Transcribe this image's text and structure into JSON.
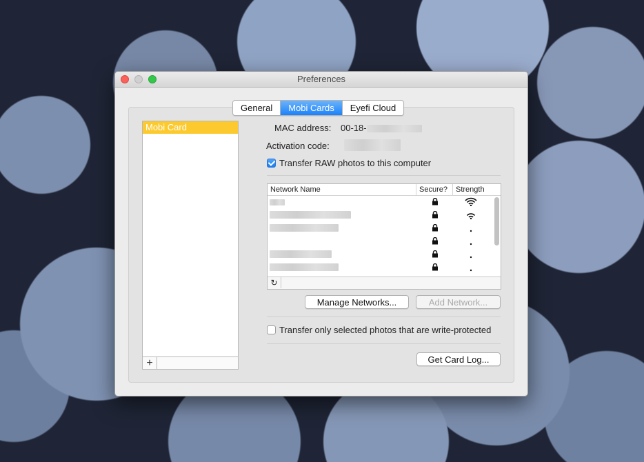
{
  "window": {
    "title": "Preferences"
  },
  "tabs": [
    {
      "label": "General",
      "active": false
    },
    {
      "label": "Mobi Cards",
      "active": true
    },
    {
      "label": "Eyefi Cloud",
      "active": false
    }
  ],
  "card_list": {
    "items": [
      "Mobi Card"
    ],
    "add_label": "+"
  },
  "fields": {
    "mac_label": "MAC address:",
    "mac_value": "00-18-",
    "activation_label": "Activation code:"
  },
  "checkboxes": {
    "raw": {
      "label": "Transfer RAW photos to this computer",
      "checked": true
    },
    "protected": {
      "label": "Transfer only selected photos that are write-protected",
      "checked": false
    }
  },
  "networks": {
    "columns": [
      "Network Name",
      "Secure?",
      "Strength"
    ],
    "rows": [
      {
        "secure_icon": "lock-icon",
        "strength_icon": "wifi-strong-icon"
      },
      {
        "secure_icon": "lock-icon",
        "strength_icon": "wifi-medium-icon"
      },
      {
        "secure_icon": "lock-icon",
        "strength_icon": "wifi-weak-icon"
      },
      {
        "secure_icon": "lock-icon",
        "strength_icon": "wifi-weak-icon"
      },
      {
        "secure_icon": "lock-icon",
        "strength_icon": "wifi-weak-icon"
      },
      {
        "secure_icon": "lock-icon",
        "strength_icon": "wifi-weak-icon"
      }
    ],
    "refresh_icon": "refresh-icon"
  },
  "buttons": {
    "manage": "Manage Networks...",
    "add": "Add Network...",
    "log": "Get Card Log..."
  }
}
